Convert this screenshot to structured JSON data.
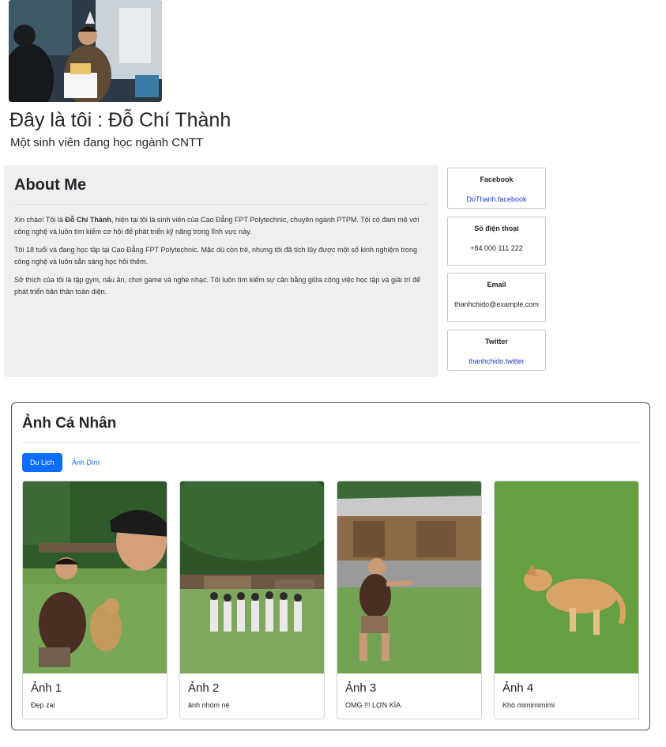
{
  "header": {
    "title": "Đây là tôi : Đỗ Chí Thành",
    "subtitle": "Một sinh viên đang học ngành CNTT"
  },
  "about": {
    "heading": "About Me",
    "p1_pre": "Xin chào! Tôi là ",
    "p1_name": "Đỗ Chí Thành",
    "p1_post": ", hiện tại tôi là sinh viên của Cao Đẳng FPT Polytechnic, chuyên ngành PTPM. Tôi có đam mê với công nghệ và luôn tìm kiếm cơ hội để phát triển kỹ năng trong lĩnh vực này.",
    "p2": "Tôi 18 tuổi và đang học tập tại Cao Đẳng FPT Polytechnic. Mặc dù còn trẻ, nhưng tôi đã tích lũy được một số kinh nghiệm trong công nghệ và luôn sẵn sàng học hỏi thêm.",
    "p3": "Sở thích của tôi là tập gym, nấu ăn, chơi game và nghe nhạc. Tôi luôn tìm kiếm sự cân bằng giữa công việc học tập và giải trí để phát triển bản thân toàn diện."
  },
  "contacts": [
    {
      "title": "Facebook",
      "value": "DoThanh.facebook"
    },
    {
      "title": "Số điện thoại",
      "value": "+84 000 111 222"
    },
    {
      "title": "Email",
      "value": "thanhchido@example.com"
    },
    {
      "title": "Twitter",
      "value": "thanhchido.twitter"
    }
  ],
  "gallery": {
    "heading": "Ảnh Cá Nhân",
    "tabs": [
      {
        "label": "Du Lịch",
        "active": true
      },
      {
        "label": "Ảnh Dìm",
        "active": false
      }
    ],
    "cards": [
      {
        "title": "Ảnh 1",
        "text": "Đẹp zai"
      },
      {
        "title": "Ảnh 2",
        "text": "ảnh nhóm nè"
      },
      {
        "title": "Ảnh 3",
        "text": "OMG !!! LỢN KÌA"
      },
      {
        "title": "Ảnh 4",
        "text": "Khò mimimimimi"
      }
    ]
  },
  "colors": {
    "primary": "#0d6efd",
    "link": "#1a3ccc",
    "panel": "#efefef"
  }
}
